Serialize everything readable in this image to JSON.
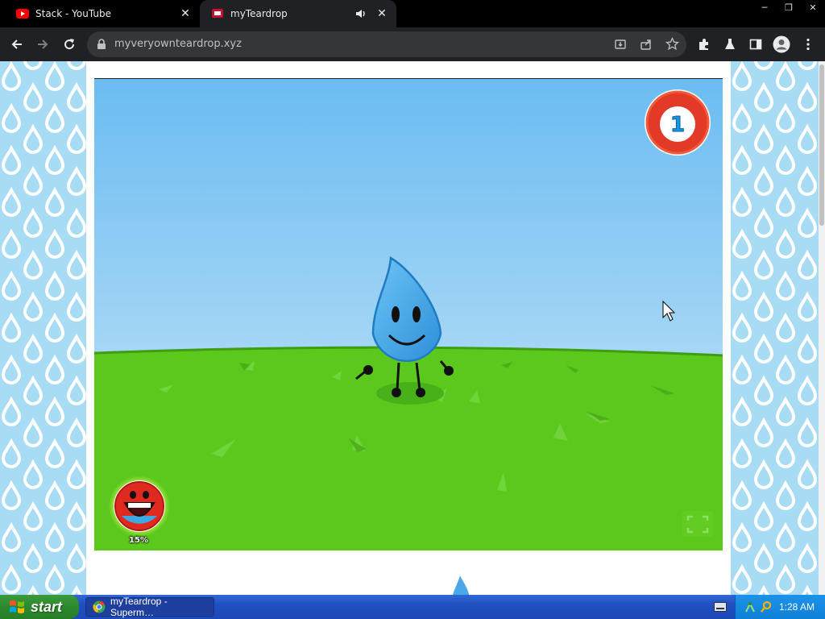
{
  "browser": {
    "tabs": [
      {
        "title": "Stack - YouTube",
        "favicon": "youtube-icon"
      },
      {
        "title": "myTeardrop",
        "favicon": "teardrop-site-icon",
        "audio": "speaker-icon"
      }
    ],
    "url": "myveryownteardrop.xyz"
  },
  "game": {
    "level": "1",
    "mood_percent": "15%",
    "character": "teardrop"
  },
  "taskbar": {
    "start_label": "start",
    "task_title": "myTeardrop - Superm…",
    "clock": "1:28 AM"
  },
  "colors": {
    "sky_top": "#6bbcf2",
    "grass": "#5bc91c",
    "drop": "#4aa8e8",
    "badge_red": "#e23a26"
  }
}
